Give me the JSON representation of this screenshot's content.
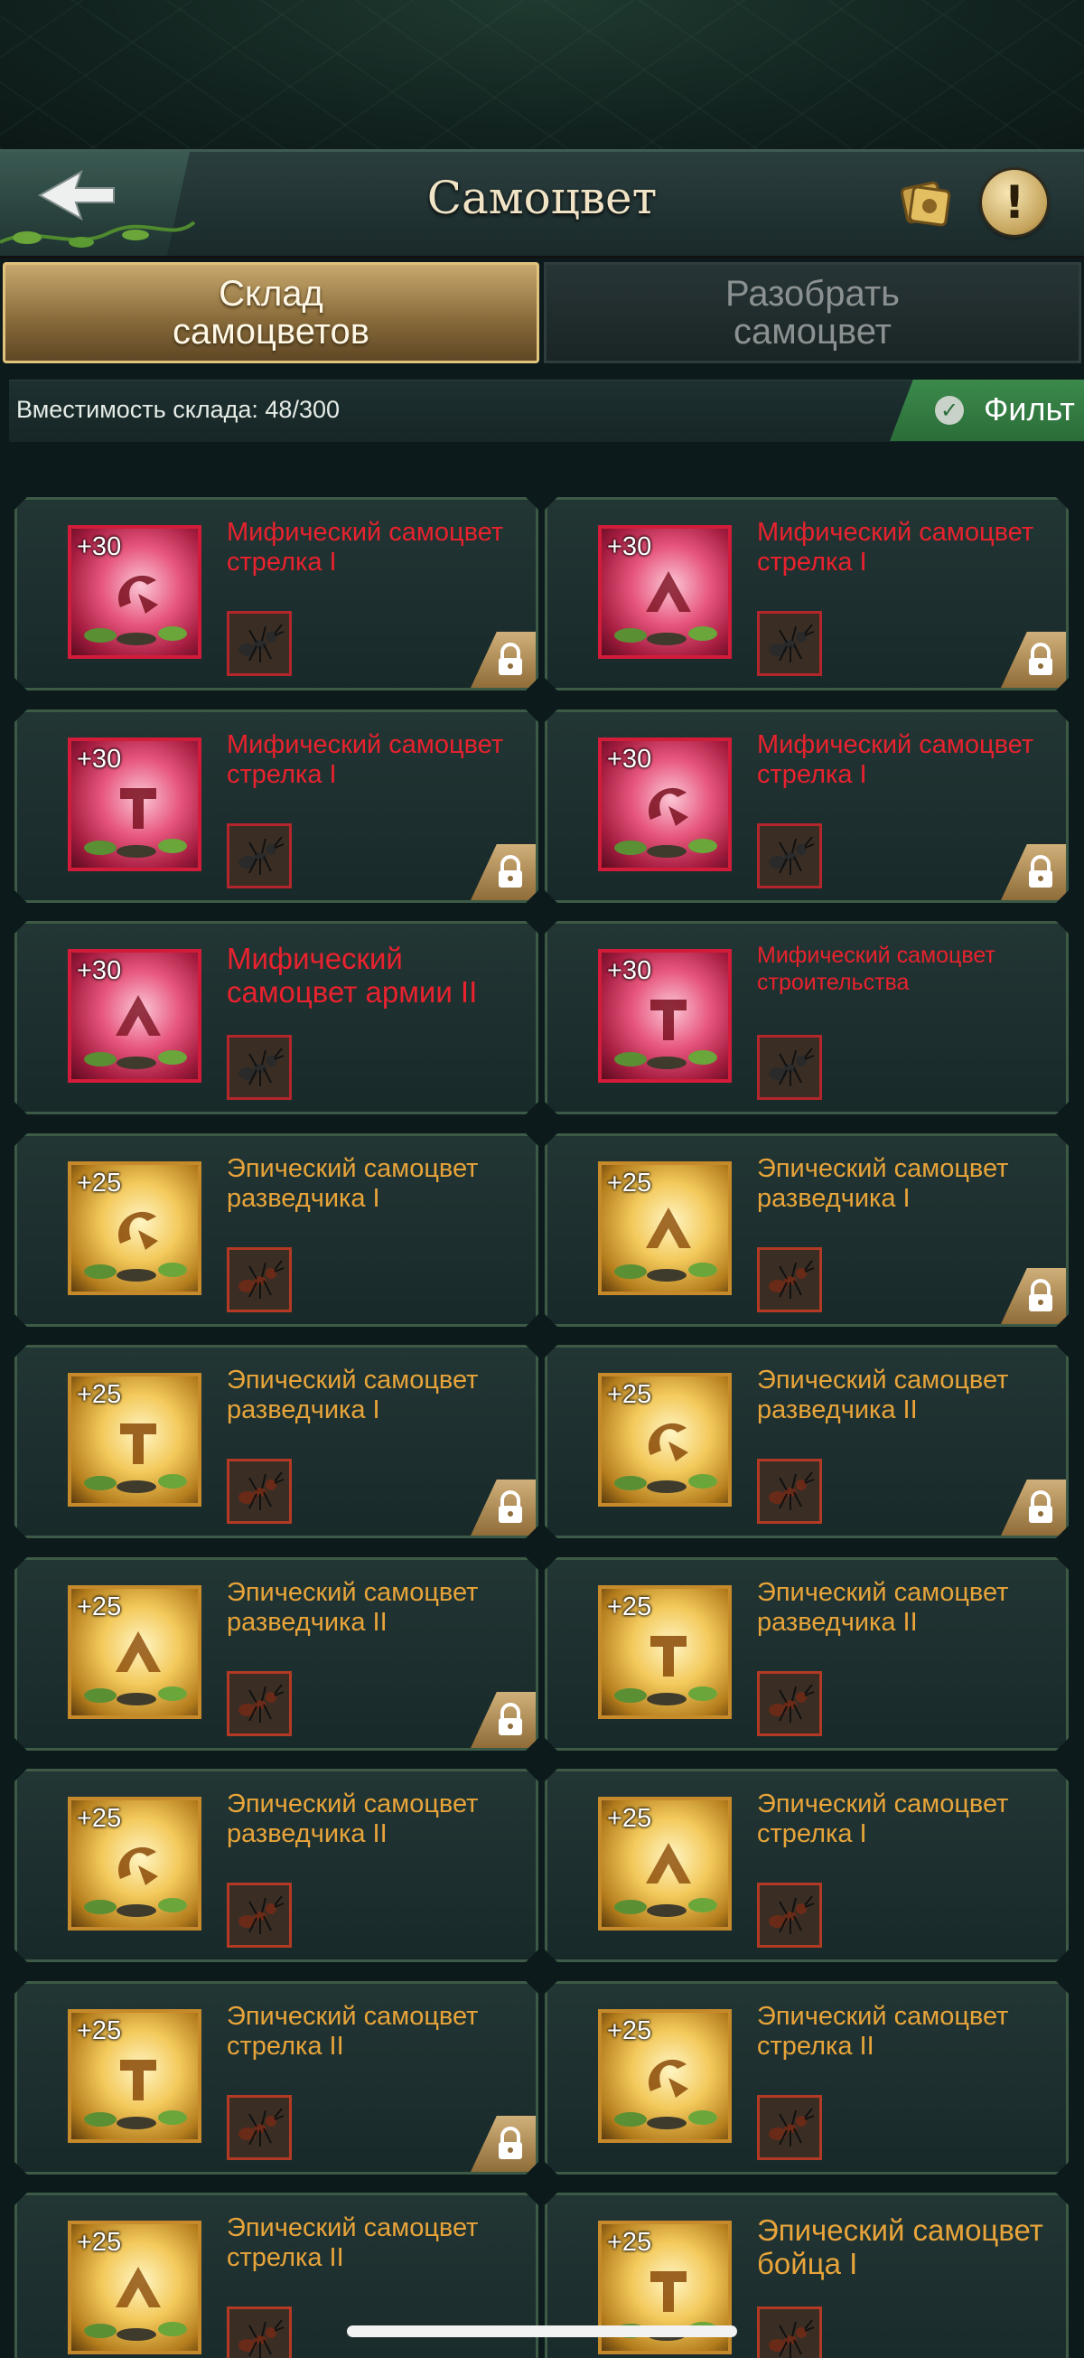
{
  "header": {
    "title": "Самоцвет",
    "back_icon": "back-arrow-icon",
    "card_icon": "card-icon",
    "info_label": "!"
  },
  "tabs": [
    {
      "label": "Склад самоцветов",
      "active": true
    },
    {
      "label": "Разобрать самоцвет",
      "active": false
    }
  ],
  "capacity": {
    "text": "Вместимость склада: 48/300"
  },
  "filter": {
    "label": "Фильт"
  },
  "colors": {
    "mythic": "#e8222e",
    "epic": "#e8a43a",
    "filter_green": "#2a6d38",
    "gold": "#c7a86d"
  },
  "gems": [
    {
      "level": "+30",
      "name": "Мифический самоцвет стрелка I",
      "rarity": "mythic",
      "locked": true,
      "ant": "ant-icon"
    },
    {
      "level": "+30",
      "name": "Мифический самоцвет стрелка I",
      "rarity": "mythic",
      "locked": true,
      "ant": "ant-icon"
    },
    {
      "level": "+30",
      "name": "Мифический самоцвет стрелка I",
      "rarity": "mythic",
      "locked": true,
      "ant": "ant-icon"
    },
    {
      "level": "+30",
      "name": "Мифический самоцвет стрелка I",
      "rarity": "mythic",
      "locked": true,
      "ant": "ant-icon"
    },
    {
      "level": "+30",
      "name": "Мифический самоцвет армии II",
      "rarity": "mythic",
      "locked": false,
      "ant": "ant-icon"
    },
    {
      "level": "+30",
      "name": "Мифический самоцвет строительства",
      "rarity": "mythic",
      "locked": false,
      "ant": "spider-icon"
    },
    {
      "level": "+25",
      "name": "Эпический самоцвет разведчика I",
      "rarity": "epic",
      "locked": false,
      "ant": "ant-icon"
    },
    {
      "level": "+25",
      "name": "Эпический самоцвет разведчика I",
      "rarity": "epic",
      "locked": true,
      "ant": "ant-icon"
    },
    {
      "level": "+25",
      "name": "Эпический самоцвет разведчика I",
      "rarity": "epic",
      "locked": true,
      "ant": "ant-icon"
    },
    {
      "level": "+25",
      "name": "Эпический самоцвет разведчика II",
      "rarity": "epic",
      "locked": true,
      "ant": "ant-icon"
    },
    {
      "level": "+25",
      "name": "Эпический самоцвет разведчика II",
      "rarity": "epic",
      "locked": true,
      "ant": "ant-icon"
    },
    {
      "level": "+25",
      "name": "Эпический самоцвет разведчика II",
      "rarity": "epic",
      "locked": false,
      "ant": "ant-icon"
    },
    {
      "level": "+25",
      "name": "Эпический самоцвет разведчика II",
      "rarity": "epic",
      "locked": false,
      "ant": "ant-icon"
    },
    {
      "level": "+25",
      "name": "Эпический самоцвет стрелка I",
      "rarity": "epic",
      "locked": false,
      "ant": "ant-icon"
    },
    {
      "level": "+25",
      "name": "Эпический самоцвет стрелка II",
      "rarity": "epic",
      "locked": true,
      "ant": "ant-icon"
    },
    {
      "level": "+25",
      "name": "Эпический самоцвет стрелка II",
      "rarity": "epic",
      "locked": false,
      "ant": "ant-icon"
    },
    {
      "level": "+25",
      "name": "Эпический самоцвет стрелка II",
      "rarity": "epic",
      "locked": false,
      "ant": "ant-icon"
    },
    {
      "level": "+25",
      "name": "Эпический самоцвет бойца I",
      "rarity": "epic",
      "locked": false,
      "ant": "ant-icon"
    }
  ]
}
